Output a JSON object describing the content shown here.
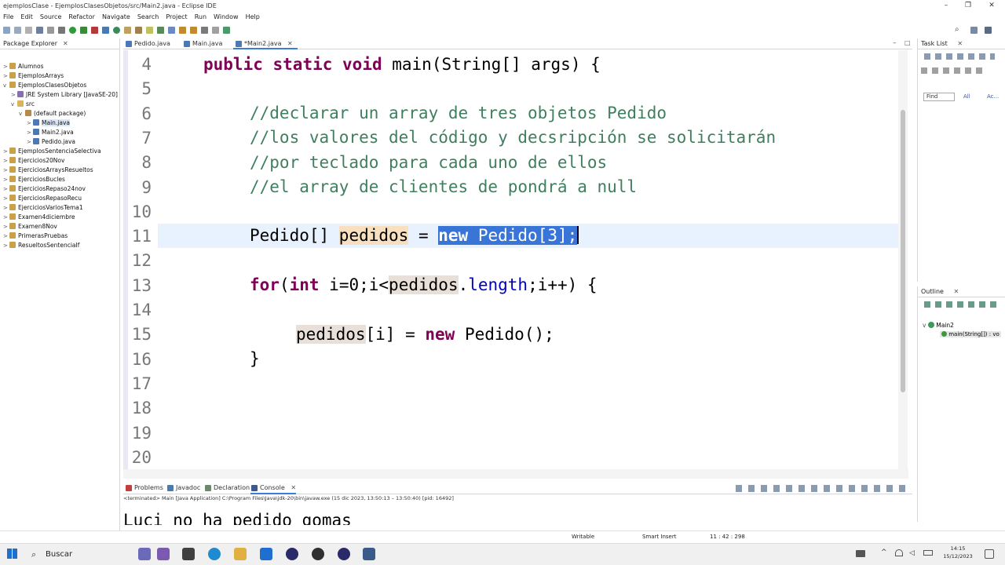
{
  "window": {
    "title": "ejemplosClase - EjemplosClasesObjetos/src/Main2.java - Eclipse IDE"
  },
  "menu": [
    "File",
    "Edit",
    "Source",
    "Refactor",
    "Navigate",
    "Search",
    "Project",
    "Run",
    "Window",
    "Help"
  ],
  "package_explorer": {
    "tab": "Package Explorer",
    "items": [
      {
        "label": "Alumnos",
        "level": 0,
        "twisty": ">",
        "icon": "project-icon"
      },
      {
        "label": "EjemplosArrays",
        "level": 0,
        "twisty": ">",
        "icon": "project-icon"
      },
      {
        "label": "EjemplosClasesObjetos",
        "level": 0,
        "twisty": "v",
        "icon": "project-icon"
      },
      {
        "label": "JRE System Library [JavaSE-20]",
        "level": 1,
        "twisty": ">",
        "icon": "library-icon"
      },
      {
        "label": "src",
        "level": 1,
        "twisty": "v",
        "icon": "source-folder-icon"
      },
      {
        "label": "(default package)",
        "level": 2,
        "twisty": "v",
        "icon": "package-icon"
      },
      {
        "label": "Main.java",
        "level": 3,
        "twisty": ">",
        "icon": "java-file-icon",
        "selected": true
      },
      {
        "label": "Main2.java",
        "level": 3,
        "twisty": ">",
        "icon": "java-file-icon"
      },
      {
        "label": "Pedido.java",
        "level": 3,
        "twisty": ">",
        "icon": "java-file-icon"
      },
      {
        "label": "EjemplosSentenciaSelectiva",
        "level": 0,
        "twisty": ">",
        "icon": "project-icon"
      },
      {
        "label": "Ejercicios20Nov",
        "level": 0,
        "twisty": ">",
        "icon": "project-icon"
      },
      {
        "label": "EjerciciosArraysResueltos",
        "level": 0,
        "twisty": ">",
        "icon": "project-icon"
      },
      {
        "label": "EjerciciosBucles",
        "level": 0,
        "twisty": ">",
        "icon": "project-icon"
      },
      {
        "label": "EjerciciosRepaso24nov",
        "level": 0,
        "twisty": ">",
        "icon": "project-icon"
      },
      {
        "label": "EjerciciosRepasoRecu",
        "level": 0,
        "twisty": ">",
        "icon": "project-icon"
      },
      {
        "label": "EjerciciosVariosTema1",
        "level": 0,
        "twisty": ">",
        "icon": "project-icon"
      },
      {
        "label": "Examen4diciembre",
        "level": 0,
        "twisty": ">",
        "icon": "project-icon"
      },
      {
        "label": "Examen8Nov",
        "level": 0,
        "twisty": ">",
        "icon": "project-icon"
      },
      {
        "label": "PrimerasPruebas",
        "level": 0,
        "twisty": ">",
        "icon": "project-icon"
      },
      {
        "label": "ResueltosSentenciaIf",
        "level": 0,
        "twisty": ">",
        "icon": "project-icon"
      }
    ]
  },
  "editor_tabs": [
    {
      "label": "Pedido.java",
      "active": false
    },
    {
      "label": "Main.java",
      "active": false
    },
    {
      "label": "*Main2.java",
      "active": true
    }
  ],
  "editor": {
    "line_numbers": [
      "4",
      "5",
      "6",
      "7",
      "8",
      "9",
      "10",
      "11",
      "12",
      "13",
      "14",
      "15",
      "16",
      "17",
      "18",
      "19",
      "20"
    ],
    "lines": {
      "l4_kw1": "public",
      "l4_kw2": "static",
      "l4_kw3": "void",
      "l4_rest": " main(String[] args) {",
      "l6": "//declarar un array de tres objetos Pedido",
      "l7": "//los valores del código y decsripción se solicitarán",
      "l8": "//por teclado para cada uno de ellos",
      "l9": "//el array de clientes de pondrá a null",
      "l11_type": "Pedido[] ",
      "l11_var": "pedidos",
      "l11_eq": " = ",
      "l11_new": "new",
      "l11_rest": " Pedido[3];",
      "l13_for": "for",
      "l13_open": "(",
      "l13_int": "int",
      "l13_mid": " i=0;i<",
      "l13_var": "pedidos",
      "l13_dot": ".",
      "l13_len": "length",
      "l13_end": ";i++) {",
      "l15_var": "pedidos",
      "l15_mid": "[i] = ",
      "l15_new": "new",
      "l15_rest": " Pedido();",
      "l16": "}"
    }
  },
  "bottom_tabs": [
    {
      "label": "Problems",
      "active": false
    },
    {
      "label": "Javadoc",
      "active": false
    },
    {
      "label": "Declaration",
      "active": false
    },
    {
      "label": "Console",
      "active": true
    }
  ],
  "console": {
    "info": "<terminated> Main [Java Application] C:\\Program Files\\Java\\jdk-20\\bin\\javaw.exe (15 dic 2023, 13:50:13 – 13:50:40) [pid: 16492]",
    "output": "Luci no ha pedido gomas"
  },
  "task_list": {
    "tab": "Task List",
    "find_placeholder": "Find",
    "filter_all": "All",
    "filter_activate": "Ac..."
  },
  "outline": {
    "tab": "Outline",
    "class_name": "Main2",
    "method": "main(String[]) : vo"
  },
  "status": {
    "writable": "Writable",
    "insert_mode": "Smart Insert",
    "position": "11 : 42 : 298"
  },
  "taskbar": {
    "search_label": "Buscar",
    "time": "14:15",
    "date": "15/12/2023"
  },
  "colors": {
    "keyword": "#7f0055",
    "comment": "#3f7f5f",
    "field": "#0000c0",
    "selection": "#3875d7",
    "current_line": "#e8f2fe"
  }
}
